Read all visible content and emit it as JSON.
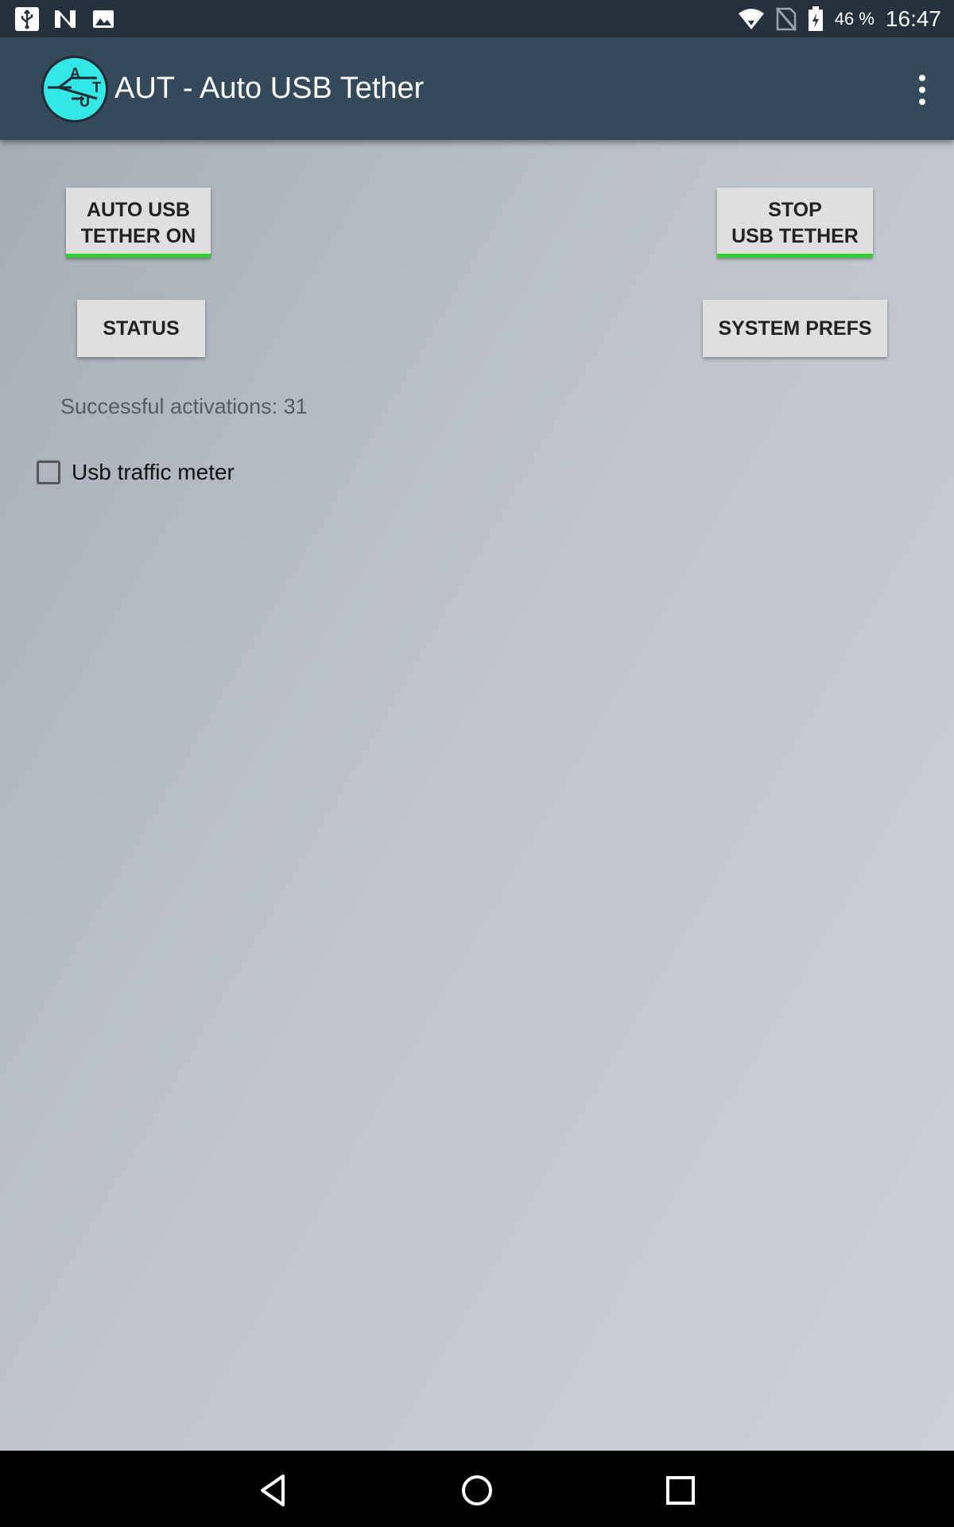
{
  "status_bar": {
    "left_icons": [
      "usb-icon",
      "n-notification-icon",
      "image-icon"
    ],
    "right_icons": [
      "wifi-icon",
      "no-sim-icon",
      "battery-icon"
    ],
    "battery_percent": "46 %",
    "time": "16:47"
  },
  "app_bar": {
    "title": "AUT - Auto USB Tether",
    "logo_letters": [
      "A",
      "T",
      "U"
    ],
    "menu_icon": "overflow-menu-icon"
  },
  "buttons": {
    "auto_usb_tether_on": [
      "AUTO USB",
      "TETHER ON"
    ],
    "stop_usb_tether": [
      "STOP",
      "USB TETHER"
    ],
    "status": "STATUS",
    "system_prefs": "SYSTEM PREFS"
  },
  "activations_text": "Successful activations: 31",
  "usb_traffic_meter": {
    "label": "Usb traffic meter",
    "checked": false
  },
  "colors": {
    "status_bar": "#25313c",
    "app_bar": "#34495a",
    "button_bg": "#dfdfdf",
    "active_underline": "#2ed02e",
    "logo_fill": "#31e8e6"
  },
  "nav_bar": {
    "icons": [
      "back-icon",
      "home-icon",
      "recents-icon"
    ]
  }
}
